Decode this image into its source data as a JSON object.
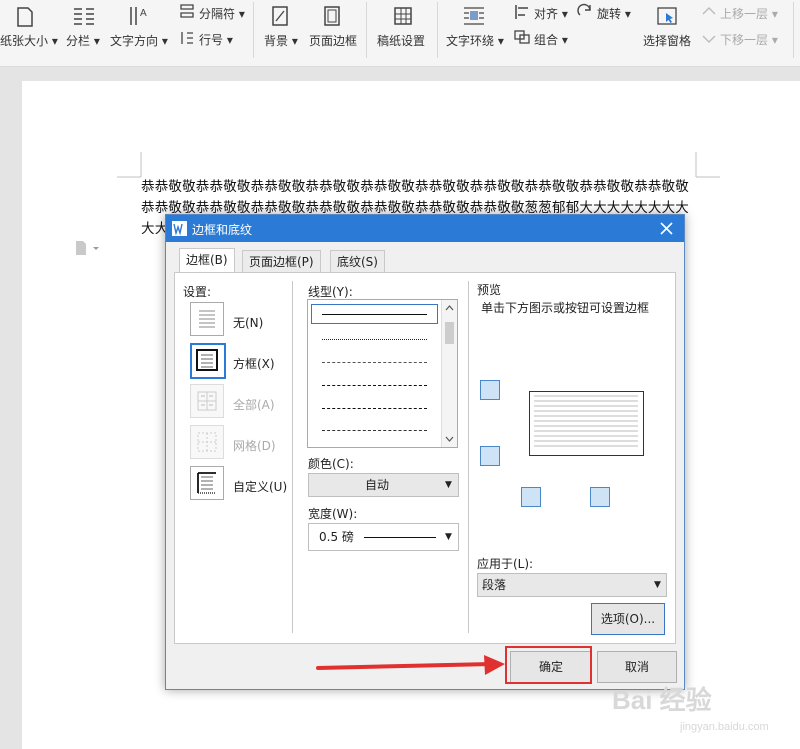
{
  "toolbar": {
    "paper_size": "纸张大小",
    "columns": "分栏",
    "text_direction": "文字方向",
    "break_symbol": "分隔符",
    "line_number": "行号",
    "background": "背景",
    "page_border": "页面边框",
    "manuscript_setting": "稿纸设置",
    "text_wrap": "文字环绕",
    "align": "对齐",
    "rotate": "旋转",
    "group": "组合",
    "selection_pane": "选择窗格",
    "bring_forward": "上移一层",
    "send_backward": "下移一层"
  },
  "document": {
    "text": "恭恭敬敬恭恭敬敬恭恭敬敬恭恭敬敬恭恭敬敬恭恭敬敬恭恭敬敬恭恭敬敬恭恭敬敬恭恭敬敬恭恭敬敬恭恭敬敬恭恭敬敬恭恭敬敬恭恭敬敬恭恭敬敬恭恭敬敬葱葱郁郁大大大大大大大大大大大大大大大大大大大大大大大大大大大大大大大大大大大大大大大大田田田田田田"
  },
  "dialog": {
    "title": "边框和底纹",
    "tabs": [
      "边框(B)",
      "页面边框(P)",
      "底纹(S)"
    ],
    "settings_label": "设置:",
    "settings": [
      {
        "label": "无(N)",
        "enabled": true
      },
      {
        "label": "方框(X)",
        "enabled": true
      },
      {
        "label": "全部(A)",
        "enabled": false
      },
      {
        "label": "网格(D)",
        "enabled": false
      },
      {
        "label": "自定义(U)",
        "enabled": true
      }
    ],
    "line_style_label": "线型(Y):",
    "color_label": "颜色(C):",
    "color_value": "自动",
    "width_label": "宽度(W):",
    "width_value": "0.5 磅",
    "preview_label": "预览",
    "preview_hint": "单击下方图示或按钮可设置边框",
    "apply_to_label": "应用于(L):",
    "apply_to_value": "段落",
    "options_button": "选项(O)...",
    "ok_button": "确定",
    "cancel_button": "取消"
  },
  "watermark": {
    "brand": "Bai  经验",
    "url": "jingyan.baidu.com"
  },
  "colors": {
    "dialog_title_bar": "#2b7bd6",
    "annotation_arrow": "#e03030"
  }
}
